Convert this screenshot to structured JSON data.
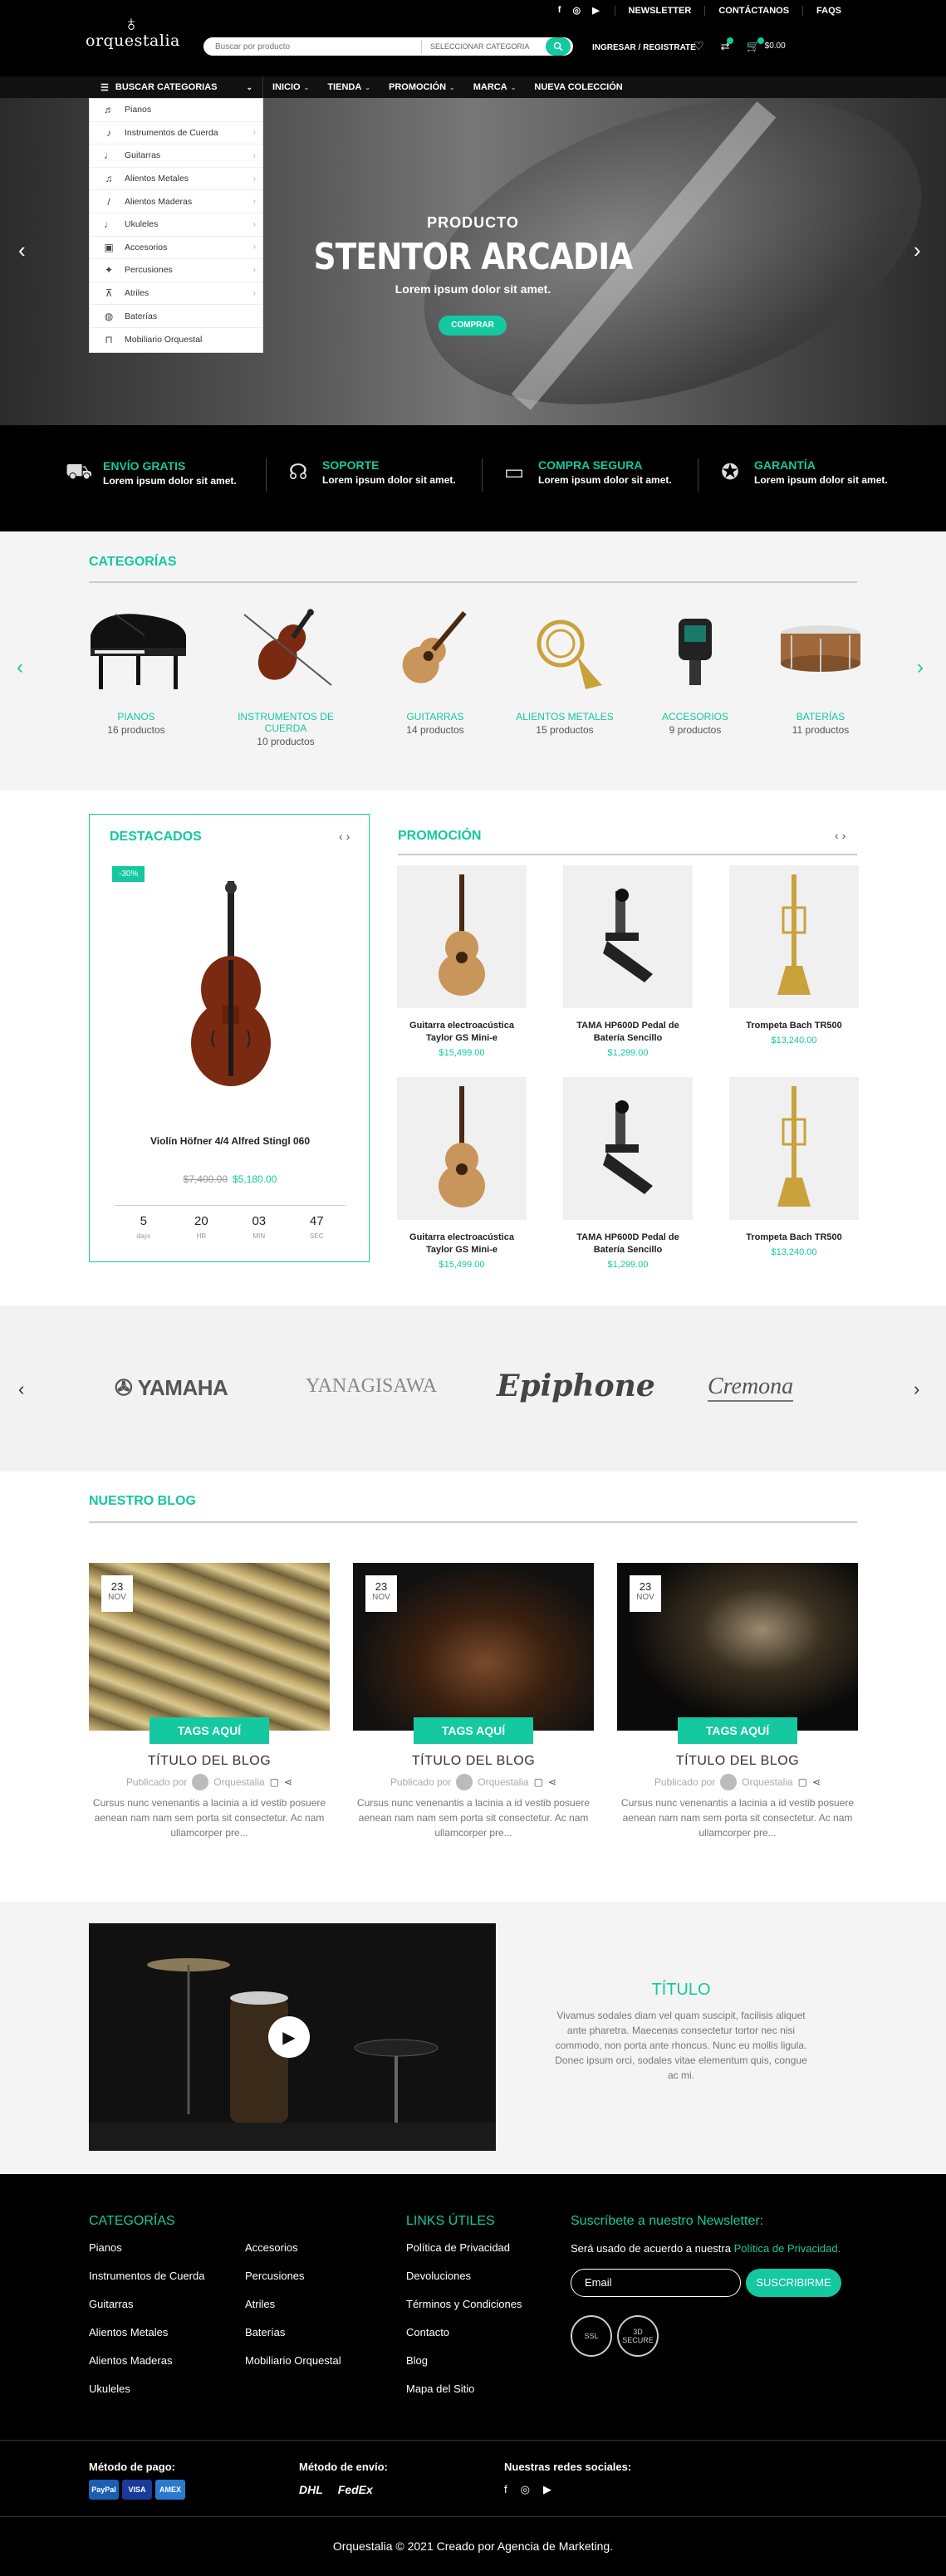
{
  "header": {
    "top_links": [
      "NEWSLETTER",
      "CONTÁCTANOS",
      "FAQS"
    ],
    "logo_text": "orquestalia",
    "search_placeholder": "Buscar por producto",
    "search_category": "SELECCIONAR CATEGORIA",
    "account": "INGRESAR / REGISTRATE",
    "cart_total": "$0.00"
  },
  "nav": {
    "categories_button": "BUSCAR CATEGORIAS",
    "items": [
      "INICIO",
      "TIENDA",
      "PROMOCIÓN",
      "MARCA",
      "NUEVA COLECCIÓN"
    ]
  },
  "dropdown": {
    "items": [
      "Pianos",
      "Instrumentos de Cuerda",
      "Guitarras",
      "Alientos Metales",
      "Alientos Maderas",
      "Ukuleles",
      "Accesorios",
      "Percusiones",
      "Atriles",
      "Baterías",
      "Mobiliario Orquestal"
    ]
  },
  "hero": {
    "pretitle": "PRODUCTO",
    "title": "STENTOR ARCADIA",
    "subtitle": "Lorem ipsum dolor sit amet.",
    "button": "COMPRAR"
  },
  "features": [
    {
      "title": "ENVÍO GRATIS",
      "text": "Lorem ipsum dolor sit amet.",
      "icon": "truck-icon"
    },
    {
      "title": "SOPORTE",
      "text": "Lorem ipsum dolor sit amet.",
      "icon": "headset-icon"
    },
    {
      "title": "COMPRA SEGURA",
      "text": "Lorem ipsum dolor sit amet.",
      "icon": "card-icon"
    },
    {
      "title": "GARANTÍA",
      "text": "Lorem ipsum dolor sit amet.",
      "icon": "ribbon-icon"
    }
  ],
  "categories": {
    "title": "CATEGORÍAS",
    "items": [
      {
        "name": "PIANOS",
        "count": "16 productos"
      },
      {
        "name": "INSTRUMENTOS DE CUERDA",
        "count": "10 productos"
      },
      {
        "name": "GUITARRAS",
        "count": "14 productos"
      },
      {
        "name": "ALIENTOS METALES",
        "count": "15 productos"
      },
      {
        "name": "ACCESORIOS",
        "count": "9 productos"
      },
      {
        "name": "BATERÍAS",
        "count": "11 productos"
      }
    ]
  },
  "featured": {
    "title": "DESTACADOS",
    "discount": "-30%",
    "name": "Violín Höfner 4/4 Alfred Stingl 060",
    "old_price": "$7,400.00",
    "price": "$5,180.00",
    "countdown": [
      {
        "value": "5",
        "unit": "days"
      },
      {
        "value": "20",
        "unit": "HR"
      },
      {
        "value": "03",
        "unit": "MIN"
      },
      {
        "value": "47",
        "unit": "SEC"
      }
    ]
  },
  "promo": {
    "title": "PROMOCIÓN",
    "products": [
      {
        "name": "Guitarra electroacústica Taylor GS Mini-e",
        "price": "$15,499.00"
      },
      {
        "name": "TAMA HP600D Pedal de Batería Sencillo",
        "price": "$1,299.00"
      },
      {
        "name": "Trompeta Bach TR500",
        "price": "$13,240.00"
      },
      {
        "name": "Guitarra electroacústica Taylor GS Mini-e",
        "price": "$15,499.00"
      },
      {
        "name": "TAMA HP600D Pedal de Batería Sencillo",
        "price": "$1,299.00"
      },
      {
        "name": "Trompeta Bach TR500",
        "price": "$13,240.00"
      }
    ]
  },
  "brands": [
    "YAMAHA",
    "YANAGISAWA",
    "Epiphone",
    "Cremona"
  ],
  "blog": {
    "title": "NUESTRO BLOG",
    "posts": [
      {
        "day": "23",
        "month": "NOV",
        "tag": "TAGS AQUÍ",
        "title": "TÍTULO DEL BLOG",
        "by": "Publicado por",
        "author": "Orquestalia",
        "excerpt": "Cursus nunc venenantis a lacinia a id vestib posuere aenean nam nam sem porta sit consectetur. Ac nam ullamcorper pre..."
      },
      {
        "day": "23",
        "month": "NOV",
        "tag": "TAGS AQUÍ",
        "title": "TÍTULO DEL BLOG",
        "by": "Publicado por",
        "author": "Orquestalia",
        "excerpt": "Cursus nunc venenantis a lacinia a id vestib posuere aenean nam nam sem porta sit consectetur. Ac nam ullamcorper pre..."
      },
      {
        "day": "23",
        "month": "NOV",
        "tag": "TAGS AQUÍ",
        "title": "TÍTULO DEL BLOG",
        "by": "Publicado por",
        "author": "Orquestalia",
        "excerpt": "Cursus nunc venenantis a lacinia a id vestib posuere aenean nam nam sem porta sit consectetur. Ac nam ullamcorper pre..."
      }
    ]
  },
  "video": {
    "title": "TÍTULO",
    "text": "Vivamus sodales diam vel quam suscipit, facilisis aliquet ante pharetra. Maecenas consectetur tortor nec nisi commodo, non porta ante rhoncus. Nunc eu mollis ligula. Donec ipsum orci, sodales vitae elementum quis, congue ac mi."
  },
  "footer": {
    "categories_title": "CATEGORÍAS",
    "categories_col1": [
      "Pianos",
      "Instrumentos de Cuerda",
      "Guitarras",
      "Alientos Metales",
      "Alientos Maderas",
      "Ukuleles"
    ],
    "categories_col2": [
      "Accesorios",
      "Percusiones",
      "Atriles",
      "Baterías",
      "Mobiliario Orquestal"
    ],
    "links_title": "LINKS ÚTILES",
    "links": [
      "Política de Privacidad",
      "Devoluciones",
      "Términos y Condiciones",
      "Contacto",
      "Blog",
      "Mapa del Sitio"
    ],
    "newsletter_title": "Suscríbete a nuestro Newsletter:",
    "newsletter_text": "Será usado de acuerdo a nuestra",
    "newsletter_link": "Política de Privacidad.",
    "email_placeholder": "Email",
    "subscribe": "SUSCRIBIRME",
    "seal1": "SSL",
    "seal2": "3D SECURE",
    "payment_label": "Método de pago:",
    "payment_methods": [
      "PayPal",
      "VISA",
      "AMEX"
    ],
    "shipping_label": "Método de envío:",
    "shipping_methods": [
      "DHL",
      "FedEx"
    ],
    "social_label": "Nuestras redes sociales:",
    "copyright": "Orquestalia © 2021  Creado por Agencia de Marketing."
  },
  "colors": {
    "accent": "#14c8a0",
    "dark": "#000000"
  }
}
